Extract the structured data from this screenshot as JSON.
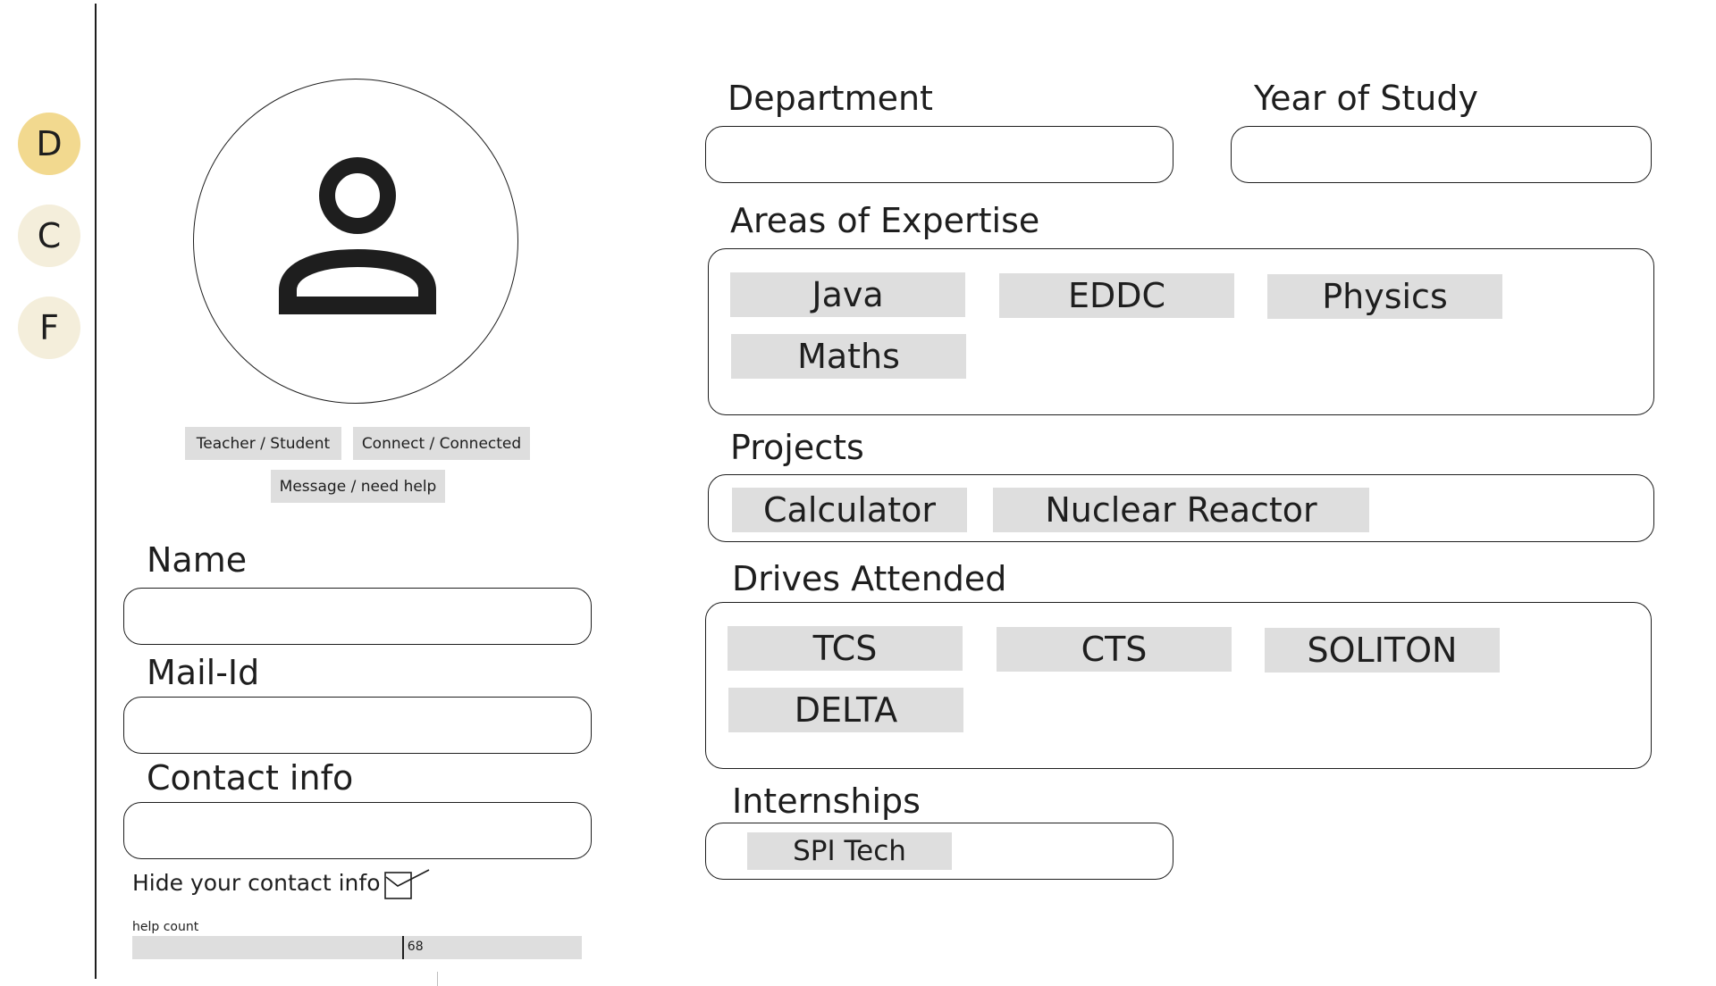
{
  "sidebar": {
    "items": [
      {
        "letter": "D",
        "active": true
      },
      {
        "letter": "C",
        "active": false
      },
      {
        "letter": "F",
        "active": false
      }
    ]
  },
  "profile": {
    "avatar_icon": "user-icon",
    "role_label": "Teacher / Student",
    "connect_label": "Connect / Connected",
    "message_label": "Message / need help"
  },
  "form": {
    "name_label": "Name",
    "name_value": "",
    "mail_label": "Mail-Id",
    "mail_value": "",
    "contact_label": "Contact info",
    "contact_value": "",
    "hide_contact_label": "Hide your contact info",
    "hide_contact_checked": true
  },
  "help": {
    "label": "help count",
    "value": "68",
    "fraction": 0.6
  },
  "academic": {
    "department_label": "Department",
    "department_value": "",
    "year_label": "Year of Study",
    "year_value": ""
  },
  "expertise": {
    "label": "Areas of Expertise",
    "items": [
      "Java",
      "EDDC",
      "Physics",
      "Maths"
    ]
  },
  "projects": {
    "label": "Projects",
    "items": [
      "Calculator",
      "Nuclear Reactor"
    ]
  },
  "drives": {
    "label": "Drives Attended",
    "items": [
      "TCS",
      "CTS",
      "SOLITON",
      "DELTA"
    ]
  },
  "internships": {
    "label": "Internships",
    "items": [
      "SPI Tech"
    ]
  },
  "colors": {
    "active_nav": "#f2d98f",
    "inactive_nav": "#f4eedb",
    "chip_bg": "#dedede",
    "ink": "#1e1e1e"
  }
}
